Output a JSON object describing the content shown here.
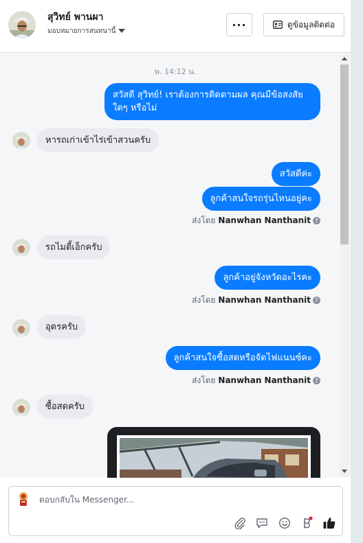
{
  "header": {
    "name": "สุวิทย์ พานผา",
    "assign_label": "มอบหมายการสนทนานี้",
    "more_label": "···",
    "view_info_label": "ดูข้อมูลติดต่อ"
  },
  "chat": {
    "timestamp": "พ. 14:12 น.",
    "sent_by_prefix": "ส่งโดย",
    "agent_name": "Nanwhan Nanthanit",
    "messages": [
      {
        "dir": "out",
        "text": "สวัสดี สุวิทย์! เราต้องการติดตามผล คุณมีข้อสงสัยใดๆ หรือไม่"
      },
      {
        "dir": "in",
        "text": "หารถเก่าเข้าไร่เข้าสวนครับ"
      },
      {
        "dir": "out",
        "text": "สวัสดีค่ะ"
      },
      {
        "dir": "out",
        "text": "ลูกค้าสนใจรถรุ่นไหนอยู่คะ"
      },
      {
        "dir": "in",
        "text": "รถไมตี้เอ็กครับ"
      },
      {
        "dir": "out",
        "text": "ลูกค้าอยู่จังหวัดอะไรคะ"
      },
      {
        "dir": "in",
        "text": "อุดรครับ"
      },
      {
        "dir": "out",
        "text": "ลูกค้าสนใจซื้อสดหรือจัดไฟแนนซ์คะ"
      },
      {
        "dir": "in",
        "text": "ซื้อสดครับ"
      }
    ]
  },
  "composer": {
    "placeholder": "ตอบกลับใน Messenger...",
    "tools": [
      "attachment-icon",
      "saved-reply-icon",
      "emoji-icon",
      "payment-icon",
      "like-icon"
    ]
  },
  "colors": {
    "outgoing_bubble": "#0a7cff",
    "incoming_bubble": "#e9ebee",
    "accent": "#1877f2"
  }
}
